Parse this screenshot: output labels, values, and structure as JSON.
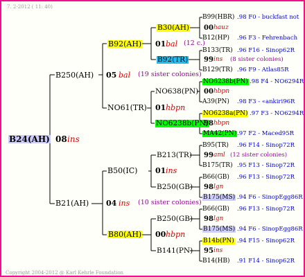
{
  "header": "7.  2-2012 ( 11: 40)",
  "footer": "Copyright 2004-2012 @ Karl Kehrle Foundation",
  "colors": {
    "frame": "#f0108c",
    "yellow": "#ffff00",
    "cyan": "#22bbee",
    "green": "#00ff00",
    "lilac": "#ccccff",
    "red": "#dd0000",
    "blue": "#0000cc",
    "purple": "#990099"
  },
  "root": {
    "id": "B24(AH)",
    "gen": "08",
    "type": "ins"
  },
  "g1": [
    {
      "id": "B250(AH)",
      "gen": "05",
      "type": "bal",
      "note": "(19 sister colonies)"
    },
    {
      "id": "B21(AH)",
      "gen": "04",
      "type": "ins",
      "note": "(10 sister colonies)"
    }
  ],
  "g2": [
    {
      "id": "B92(AH)"
    },
    {
      "id": "NO61(TR)"
    },
    {
      "id": "B50(IC)"
    },
    {
      "id": "B80(AH)"
    }
  ],
  "g3": [
    {
      "id": "B30(AH)",
      "gen": "01",
      "type": "bal",
      "note": "(12 c.)"
    },
    {
      "id": "B92(TR)"
    },
    {
      "id": "NO638(PN)",
      "gen": "01",
      "type": "hbpn"
    },
    {
      "id": "NO6238b(PN)"
    },
    {
      "id": "B213(TR)",
      "gen": "01",
      "type": "ins"
    },
    {
      "id": "B250(GB)"
    },
    {
      "id": "B250(GB)",
      "gen": "00",
      "type": "hbpn"
    },
    {
      "id": "B141(PN)"
    }
  ],
  "g4": [
    {
      "left": "B99(HBR)",
      "right": ".98   F0 - buckfast not"
    },
    {
      "left": "00",
      "type": "hauz"
    },
    {
      "left": "B12(HP)",
      "right": ".96   F3 - Fehrenbach"
    },
    {
      "left": "B133(TR)",
      "right": ".96   F16 - Sinop62R"
    },
    {
      "left": "99",
      "type": "ins",
      "note": "(8 sister colonies)"
    },
    {
      "left": "B129(TR)",
      "right": ".96   F9 - Atlas85R"
    },
    {
      "left": "NO6238b(PN)",
      "right": ".98  F4 - NO6294R"
    },
    {
      "left": "00",
      "type": "hbpn"
    },
    {
      "left": "A39(PN)",
      "right": ".98   F3 - «ankiri96R"
    },
    {
      "left": "NO6238a(PN)",
      "right": ".97  F3 - NO6294R"
    },
    {
      "left": "98",
      "type": "hbpn"
    },
    {
      "left": "MA42(PN)",
      "right": ".97   F2 - Maced95R"
    },
    {
      "left": "B95(TR)",
      "right": ".96   F14 - Sinop72R"
    },
    {
      "left": "99",
      "type": "aml",
      "note": "(12 sister colonies)"
    },
    {
      "left": "B175(TR)",
      "right": ".95   F13 - Sinop72R"
    },
    {
      "left": "B66(GB)",
      "right": ".96   F13 - Sinop72R"
    },
    {
      "left": "98",
      "type": "lgn"
    },
    {
      "left": "B175(MS)",
      "right": ".94 F6 - SinopEgg86R"
    },
    {
      "left": "B66(GB)",
      "right": ".96   F13 - Sinop72R"
    },
    {
      "left": "98",
      "type": "lgn"
    },
    {
      "left": "B175(MS)",
      "right": ".94 F6 - SinopEgg86R"
    },
    {
      "left": "B14b(PN)",
      "right": ".94   F15 - Sinop62R"
    },
    {
      "left": "95",
      "type": "ins"
    },
    {
      "left": "B14(HB)",
      "right": ".91   F14 - Sinop62R"
    }
  ]
}
